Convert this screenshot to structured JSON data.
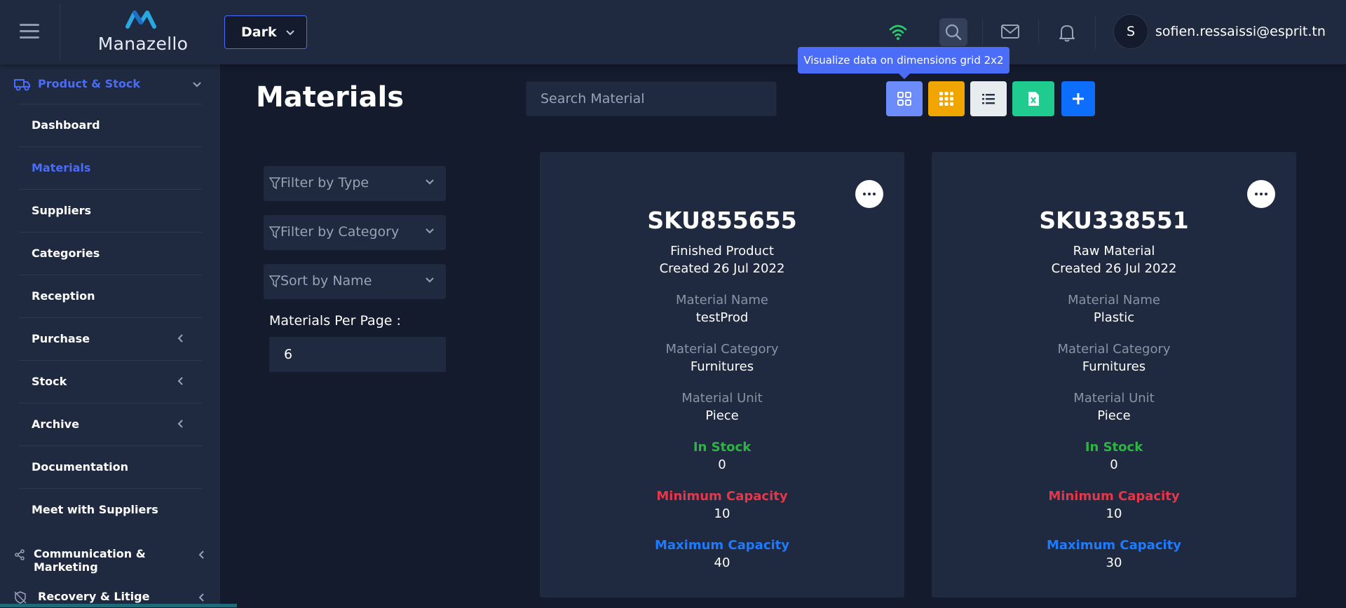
{
  "topbar": {
    "brand": "Manazello",
    "theme_value": "Dark",
    "user_initial": "S",
    "user_email": "sofien.ressaissi@esprit.tn",
    "tooltip": "Visualize data on dimensions grid 2x2",
    "status_color": "#2ecc71"
  },
  "sidebar": {
    "group_label": "Product & Stock",
    "items": [
      {
        "label": "Dashboard"
      },
      {
        "label": "Materials"
      },
      {
        "label": "Suppliers"
      },
      {
        "label": "Categories"
      },
      {
        "label": "Reception"
      },
      {
        "label": "Purchase"
      },
      {
        "label": "Stock"
      },
      {
        "label": "Archive"
      },
      {
        "label": "Documentation"
      },
      {
        "label": "Meet with Suppliers"
      }
    ],
    "sections": [
      {
        "label": "Communication & Marketing"
      },
      {
        "label": "Recovery & Litige"
      }
    ]
  },
  "main": {
    "title": "Materials",
    "search_placeholder": "Search Material",
    "view_buttons": {
      "grid_2x2": {
        "icon": "grid-2x2-icon",
        "color": "#4a6cf7"
      },
      "grid_3x3": {
        "icon": "grid-3x3-icon",
        "color": "#f0a500"
      },
      "list": {
        "icon": "list-icon",
        "color": "#e9ecef"
      },
      "excel": {
        "icon": "excel-icon",
        "color": "#1fcb8e"
      },
      "add": {
        "icon": "plus-icon",
        "color": "#0d6efd"
      }
    },
    "filters": {
      "type": "Filter by Type",
      "category": "Filter by Category",
      "sort": "Sort by Name"
    },
    "per_page_label": "Materials Per Page :",
    "per_page_value": "6"
  },
  "labels": {
    "material_name": "Material Name",
    "material_category": "Material Category",
    "material_unit": "Material Unit",
    "in_stock": "In Stock",
    "min_capacity": "Minimum Capacity",
    "max_capacity": "Maximum Capacity"
  },
  "cards": [
    {
      "sku": "SKU855655",
      "type": "Finished Product",
      "created": "Created 26 Jul 2022",
      "name": "testProd",
      "category": "Furnitures",
      "unit": "Piece",
      "in_stock": "0",
      "min_capacity": "10",
      "max_capacity": "40"
    },
    {
      "sku": "SKU338551",
      "type": "Raw Material",
      "created": "Created 26 Jul 2022",
      "name": "Plastic",
      "category": "Furnitures",
      "unit": "Piece",
      "in_stock": "0",
      "min_capacity": "10",
      "max_capacity": "30"
    }
  ]
}
